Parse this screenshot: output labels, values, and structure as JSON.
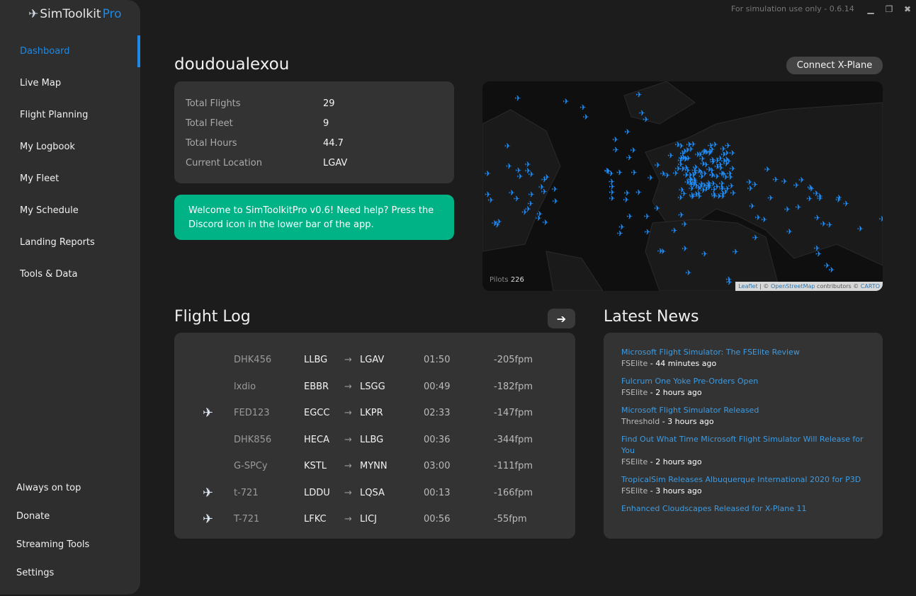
{
  "app": {
    "logo_main": "SimToolkit",
    "logo_pro": "Pro",
    "info": "For simulation use only - 0.6.14"
  },
  "sidebar": {
    "items": [
      {
        "label": "Dashboard"
      },
      {
        "label": "Live Map"
      },
      {
        "label": "Flight Planning"
      },
      {
        "label": "My Logbook"
      },
      {
        "label": "My Fleet"
      },
      {
        "label": "My Schedule"
      },
      {
        "label": "Landing Reports"
      },
      {
        "label": "Tools & Data"
      }
    ],
    "bottom": [
      {
        "label": "Always on top"
      },
      {
        "label": "Donate"
      },
      {
        "label": "Streaming Tools"
      },
      {
        "label": "Settings"
      }
    ]
  },
  "user": {
    "name": "doudoualexou",
    "connect": "Connect X-Plane"
  },
  "stats": [
    {
      "k": "Total Flights",
      "v": "29"
    },
    {
      "k": "Total Fleet",
      "v": "9"
    },
    {
      "k": "Total Hours",
      "v": "44.7"
    },
    {
      "k": "Current Location",
      "v": "LGAV"
    }
  ],
  "welcome": "Welcome to SimToolkitPro v0.6! Need help? Press the Discord icon in the lower bar of the app.",
  "map": {
    "pilots_label": "Pilots",
    "pilots_count": "226",
    "leaflet": "Leaflet",
    "sep": " | © ",
    "osm": "OpenStreetMap",
    "contrib": " contributors © ",
    "carto": "CARTO",
    "plane_color": "#1e90ff"
  },
  "flight_log": {
    "title": "Flight Log",
    "rows": [
      {
        "icon": false,
        "callsign": "DHK456",
        "from": "LLBG",
        "to": "LGAV",
        "time": "01:50",
        "fpm": "-205fpm"
      },
      {
        "icon": false,
        "callsign": "lxdio",
        "from": "EBBR",
        "to": "LSGG",
        "time": "00:49",
        "fpm": "-182fpm"
      },
      {
        "icon": true,
        "callsign": "FED123",
        "from": "EGCC",
        "to": "LKPR",
        "time": "02:33",
        "fpm": "-147fpm"
      },
      {
        "icon": false,
        "callsign": "DHK856",
        "from": "HECA",
        "to": "LLBG",
        "time": "00:36",
        "fpm": "-344fpm"
      },
      {
        "icon": false,
        "callsign": "G-SPCy",
        "from": "KSTL",
        "to": "MYNN",
        "time": "03:00",
        "fpm": "-111fpm"
      },
      {
        "icon": true,
        "callsign": "t-721",
        "from": "LDDU",
        "to": "LQSA",
        "time": "00:13",
        "fpm": "-166fpm"
      },
      {
        "icon": true,
        "callsign": "T-721",
        "from": "LFKC",
        "to": "LICJ",
        "time": "00:56",
        "fpm": "-55fpm"
      }
    ]
  },
  "news": {
    "title": "Latest News",
    "items": [
      {
        "title": "Microsoft Flight Simulator: The FSElite Review",
        "source": "FSElite",
        "ago": " - 44 minutes ago"
      },
      {
        "title": "Fulcrum One Yoke Pre-Orders Open",
        "source": "FSElite",
        "ago": " - 2 hours ago"
      },
      {
        "title": "Microsoft Flight Simulator Released",
        "source": "Threshold",
        "ago": " - 3 hours ago"
      },
      {
        "title": "Find Out What Time Microsoft Flight Simulator Will Release for You",
        "source": "FSElite",
        "ago": " - 2 hours ago"
      },
      {
        "title": "TropicalSim Releases Albuquerque International 2020 for P3D",
        "source": "FSElite",
        "ago": " - 3 hours ago"
      },
      {
        "title": "Enhanced Cloudscapes Released for X-Plane 11",
        "source": "",
        "ago": ""
      }
    ]
  }
}
